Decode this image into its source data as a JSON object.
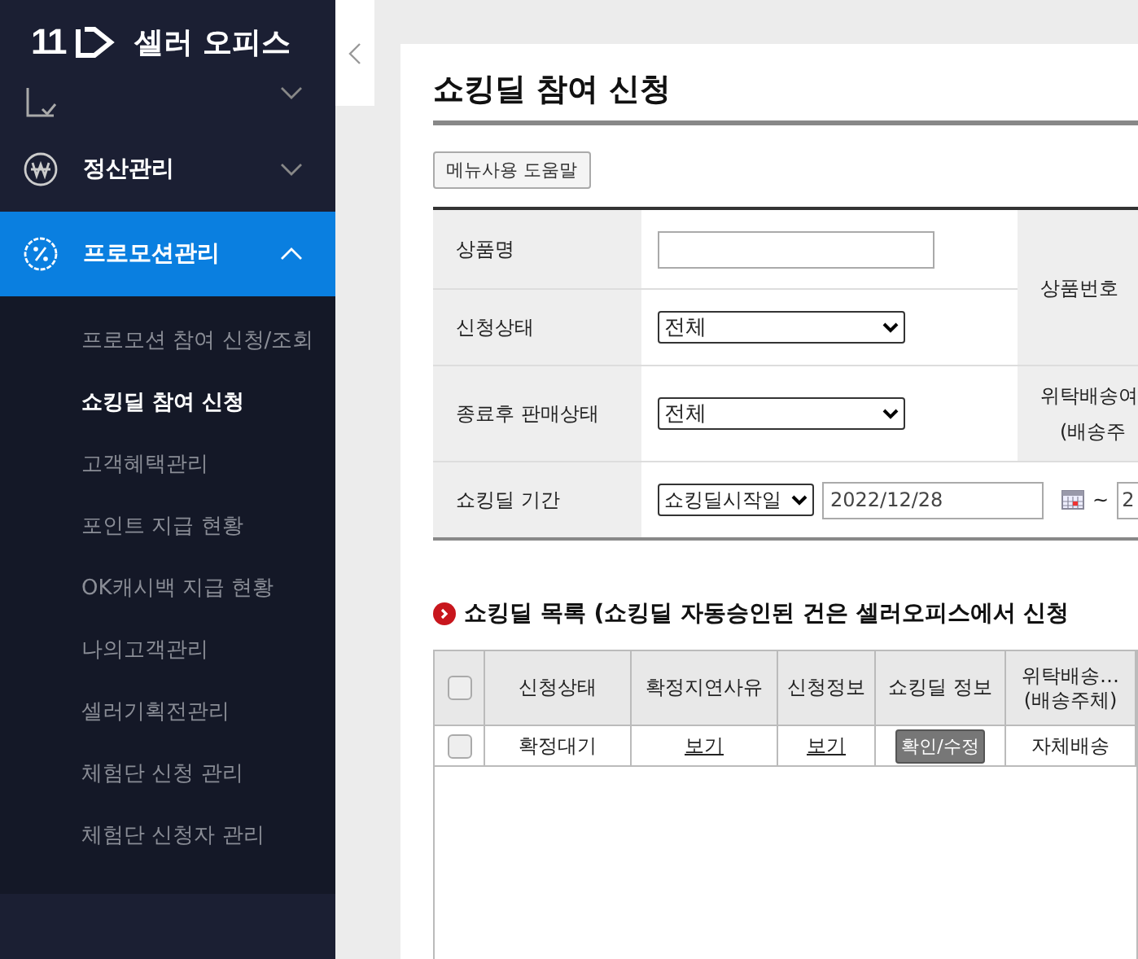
{
  "logo": {
    "mark": "11",
    "title": "셀러 오피스"
  },
  "sidebar": {
    "items": [
      {
        "kind": "check",
        "expanded": false,
        "selected": false
      },
      {
        "kind": "won",
        "label": "정산관리",
        "expanded": false,
        "selected": false
      },
      {
        "kind": "percent",
        "label": "프로모션관리",
        "expanded": true,
        "selected": true,
        "children": [
          {
            "label": "프로모션 참여 신청/조회",
            "selected": false
          },
          {
            "label": "쇼킹딜 참여 신청",
            "selected": true
          },
          {
            "label": "고객혜택관리",
            "selected": false
          },
          {
            "label": "포인트 지급 현황",
            "selected": false
          },
          {
            "label": "OK캐시백 지급 현황",
            "selected": false
          },
          {
            "label": "나의고객관리",
            "selected": false
          },
          {
            "label": "셀러기획전관리",
            "selected": false
          },
          {
            "label": "체험단 신청 관리",
            "selected": false
          },
          {
            "label": "체험단 신청자 관리",
            "selected": false
          }
        ]
      }
    ]
  },
  "page": {
    "title": "쇼킹딜 참여 신청",
    "help_button": "메뉴사용 도움말"
  },
  "search_form": {
    "product_name": {
      "label": "상품명"
    },
    "status": {
      "label": "신청상태",
      "value": "전체"
    },
    "after_status": {
      "label": "종료후 판매상태",
      "value": "전체"
    },
    "period": {
      "label": "쇼킹딜 기간",
      "type": "쇼킹딜시작일",
      "start": "2022/12/28",
      "separator": "~",
      "end": "2"
    },
    "product_number": {
      "label": "상품번호"
    },
    "delivery": {
      "label": "위탁배송여",
      "sublabel": "(배송주"
    }
  },
  "list": {
    "heading": "쇼킹딜 목록 (쇼킹딜 자동승인된 건은 셀러오피스에서 신청",
    "columns": [
      "신청상태",
      "확정지연사유",
      "신청정보",
      "쇼킹딜 정보",
      [
        "위탁배송…",
        "(배송주체)"
      ]
    ],
    "all_checked": false,
    "rows": [
      {
        "checked": false,
        "status": "확정대기",
        "delay_reason": "보기",
        "info": "보기",
        "deal_button": "확인/수정",
        "delivery": "자체배송"
      }
    ]
  }
}
